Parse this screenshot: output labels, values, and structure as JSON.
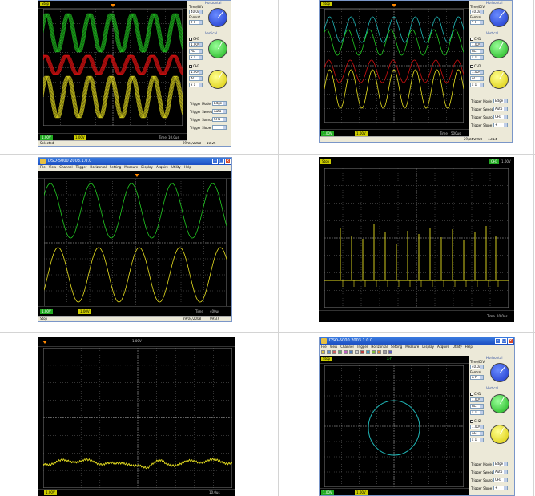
{
  "colors": {
    "ch1": "#22cc22",
    "ch2": "#e8e020",
    "ch3": "#cc1010",
    "ch_cyan": "#20b8b8",
    "grid": "#6a6a6a",
    "trigger": "#ff8800",
    "title_bar": "#1c4fc2"
  },
  "screens": [
    {
      "id": "s1",
      "stop_label": "Stop",
      "bottom": {
        "ch1": "1.00V",
        "ch2": "1.00V",
        "time": "Time",
        "time_val": "10.0us"
      },
      "status_left": "Selected",
      "date": "29/04/2008",
      "clock": "10:25",
      "panel": {
        "horizontal": "Horizontal",
        "time_div_label": "Time/DIV",
        "time_div": "40.0us",
        "format_label": "Format",
        "format": "Y-T",
        "vertical": "Vertical",
        "ch1": "CH1",
        "ch2": "CH2",
        "coupling": [
          "1.00V",
          "AC",
          "x 1"
        ],
        "coupling2": [
          "1.00V",
          "AC",
          "x 1"
        ],
        "trigger": [
          {
            "label": "Trigger Mode",
            "value": "Edge"
          },
          {
            "label": "Trigger Sweep",
            "value": "Auto"
          },
          {
            "label": "Trigger Source",
            "value": "CH1"
          },
          {
            "label": "Trigger Slope",
            "value": "+"
          }
        ]
      }
    },
    {
      "id": "s2",
      "stop_label": "Stop",
      "bottom": {
        "ch1": "1.00V",
        "ch2": "1.00V",
        "time": "Time",
        "time_val": "500us"
      },
      "date": "29/04/2008",
      "clock": "13:14",
      "panel": {
        "horizontal": "Horizontal",
        "time_div_label": "Time/DIV",
        "time_div": "40.0us",
        "format_label": "Format",
        "format": "Y-T",
        "vertical": "Vertical",
        "ch1": "CH1",
        "ch2": "CH2",
        "coupling": [
          "1.00V",
          "AC",
          "x 1"
        ],
        "coupling2": [
          "1.00V",
          "AC",
          "x 1"
        ],
        "trigger": [
          {
            "label": "Trigger Mode",
            "value": "Edge"
          },
          {
            "label": "Trigger Sweep",
            "value": "Auto"
          },
          {
            "label": "Trigger Source",
            "value": "CH1"
          },
          {
            "label": "Trigger Slope",
            "value": "+"
          }
        ]
      }
    },
    {
      "id": "s3",
      "title": "DSO-5000 2003.1.0.0",
      "menu": [
        "File",
        "View",
        "Channel",
        "Trigger",
        "Horizontal",
        "Setting",
        "Measure",
        "Display",
        "Acquire",
        "Utility",
        "Help"
      ],
      "stop_label": "Stop",
      "bottom": {
        "ch1": "1.00V",
        "ch2": "1.00V",
        "time": "Time",
        "time_val": "400us"
      },
      "status_left": "Stop",
      "date": "29/04/2008",
      "clock": "09:37"
    },
    {
      "id": "s4",
      "stop_label": "Stop",
      "ch_label": "CH1",
      "ch_val": "1.00V",
      "time": "Time",
      "time_val": "10.0us"
    },
    {
      "id": "s5",
      "title_value": "1.00V",
      "time_val": "1.00V",
      "bottom_right": "10.0us"
    },
    {
      "id": "s6",
      "title": "DSO-5000 2003.1.0.0",
      "menu": [
        "File",
        "View",
        "Channel",
        "Trigger",
        "Horizontal",
        "Setting",
        "Measure",
        "Display",
        "Acquire",
        "Utility",
        "Help"
      ],
      "stop_label": "Stop",
      "top_label": "X-Y",
      "bottom": {
        "ch1": "1.00V",
        "ch2": "1.00V"
      },
      "panel": {
        "horizontal": "Horizontal",
        "time_div_label": "Time/DIV",
        "time_div": "40.0us",
        "format_label": "Format",
        "format": "X-Y",
        "vertical": "Vertical",
        "ch1": "CH1",
        "ch2": "CH2",
        "coupling": [
          "1.00V",
          "AC",
          "x 1"
        ],
        "coupling2": [
          "1.00V",
          "AC",
          "x 1"
        ],
        "trigger": [
          {
            "label": "Trigger Mode",
            "value": "Edge"
          },
          {
            "label": "Trigger Sweep",
            "value": "Auto"
          },
          {
            "label": "Trigger Source",
            "value": "CH1"
          },
          {
            "label": "Trigger Slope",
            "value": "+"
          }
        ]
      }
    }
  ]
}
